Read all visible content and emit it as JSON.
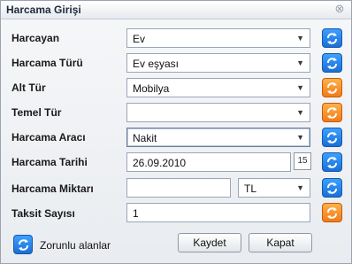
{
  "window": {
    "title": "Harcama Girişi",
    "close_symbol": "⊗"
  },
  "form": {
    "rows": [
      {
        "label": "Harcayan",
        "value": "Ev",
        "type": "select",
        "refresh": "blue"
      },
      {
        "label": "Harcama Türü",
        "value": "Ev eşyası",
        "type": "select",
        "refresh": "blue"
      },
      {
        "label": "Alt Tür",
        "value": "Mobilya",
        "type": "select",
        "refresh": "orange"
      },
      {
        "label": "Temel Tür",
        "value": "",
        "type": "select",
        "refresh": "orange"
      },
      {
        "label": "Harcama Aracı",
        "value": "Nakit",
        "type": "select",
        "refresh": "blue"
      },
      {
        "label": "Harcama Tarihi",
        "value": "26.09.2010",
        "type": "date",
        "refresh": "blue"
      },
      {
        "label": "Harcama Miktarı",
        "value": "",
        "type": "amount",
        "refresh": "blue"
      },
      {
        "label": "Taksit Sayısı",
        "value": "1",
        "type": "text",
        "refresh": "orange"
      }
    ],
    "currency": "TL",
    "calendar_day": "15"
  },
  "footer": {
    "required_label": "Zorunlu alanlar",
    "save_label": "Kaydet",
    "close_label": "Kapat"
  },
  "colors": {
    "blue_button": "#1a6fd6",
    "orange_button": "#f27a18"
  }
}
